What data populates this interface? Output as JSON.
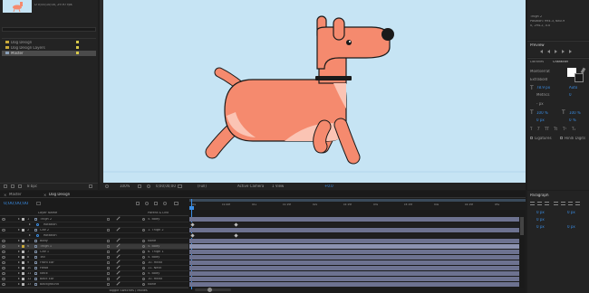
{
  "project": {
    "comp_info_line1": "D 0;00;10;00, 29.97 fps",
    "items": [
      {
        "name": "Dog Design",
        "kind": "folder",
        "color": "#d8c94a"
      },
      {
        "name": "Dog Design Layers",
        "kind": "folder",
        "color": "#d8c94a"
      },
      {
        "name": "Master",
        "kind": "comp",
        "color": "#d8c94a"
      }
    ],
    "bpc": "8 bpc"
  },
  "viewer": {
    "zoom": "100%",
    "timecode": "0;00;00;00",
    "resolution": "(Full)",
    "camera": "Active Camera",
    "views": "1 View",
    "exposure": "+0.0"
  },
  "info_panel": {
    "line1": "Thigh 2",
    "line2": "Position: 994.3, 680.9",
    "line3": "0, 294.2, 0.0"
  },
  "preview_panel": {
    "title": "Preview"
  },
  "character_panel": {
    "tab_libraries": "Libraries",
    "tab_character": "Character",
    "font_family": "Montserrat",
    "font_style": "Extrabold",
    "font_size": "78.9 px",
    "leading": "Auto",
    "kerning": "Metrics",
    "tracking": "0",
    "stroke_width": "- px",
    "vert_scale": "100 %",
    "horiz_scale": "100 %",
    "baseline": "0 px",
    "tsume": "0 %",
    "ligatures": "Ligatures",
    "hindi_digits": "Hindi Digits"
  },
  "paragraph_panel": {
    "title": "Paragraph",
    "values": [
      "0 px",
      "0 px",
      "0 px",
      "0 px",
      "0 px"
    ]
  },
  "timeline": {
    "tabs": [
      "Master",
      "Dog Design"
    ],
    "timecode": "0;00;00;00",
    "header_layer": "Layer Name",
    "header_parent": "Parent & Link",
    "time_marks": [
      "00s",
      "01:00f",
      "01s",
      "01:15f",
      "02s",
      "02:15f",
      "03s",
      "03:15f",
      "04s",
      "04:15f",
      "05s"
    ],
    "footer": "Toggle Switches / Modes",
    "layers": [
      {
        "num": "1",
        "name": "Thigh 2",
        "parent": "5. Body",
        "color": "#b4b4b4",
        "indent": 0
      },
      {
        "num": "",
        "name": "Rotation",
        "parent": "",
        "color": "",
        "indent": 1
      },
      {
        "num": "2",
        "name": "Calf 2",
        "parent": "1. Thigh 2",
        "color": "#b4b4b4",
        "indent": 0
      },
      {
        "num": "",
        "name": "Rotation",
        "parent": "",
        "color": "",
        "indent": 1
      },
      {
        "num": "5",
        "name": "Body",
        "parent": "None",
        "color": "#b4b4b4",
        "indent": 0
      },
      {
        "num": "6",
        "name": "Thigh 1",
        "parent": "5. Body",
        "color": "#c9a93a",
        "indent": 0
      },
      {
        "num": "7",
        "name": "Calf 1",
        "parent": "6. Thigh 1",
        "color": "#b4b4b4",
        "indent": 0
      },
      {
        "num": "8",
        "name": "Tail",
        "parent": "5. Body",
        "color": "#b4b4b4",
        "indent": 0
      },
      {
        "num": "9",
        "name": "Front Ear",
        "parent": "10. Head",
        "color": "#b4b4b4",
        "indent": 0
      },
      {
        "num": "10",
        "name": "Head",
        "parent": "11. Neck",
        "color": "#b4b4b4",
        "indent": 0
      },
      {
        "num": "11",
        "name": "Neck",
        "parent": "5. Body",
        "color": "#b4b4b4",
        "indent": 0
      },
      {
        "num": "12",
        "name": "Back Ear",
        "parent": "10. Head",
        "color": "#b4b4b4",
        "indent": 0
      },
      {
        "num": "13",
        "name": "Background",
        "parent": "None",
        "color": "#b4b4b4",
        "indent": 0
      }
    ]
  },
  "colors": {
    "canvas": "#c6e4f4",
    "dog": "#f58a6e",
    "dog_light": "#fbc4b4",
    "outline": "#1a1a1a",
    "accent": "#3a8ee6"
  }
}
